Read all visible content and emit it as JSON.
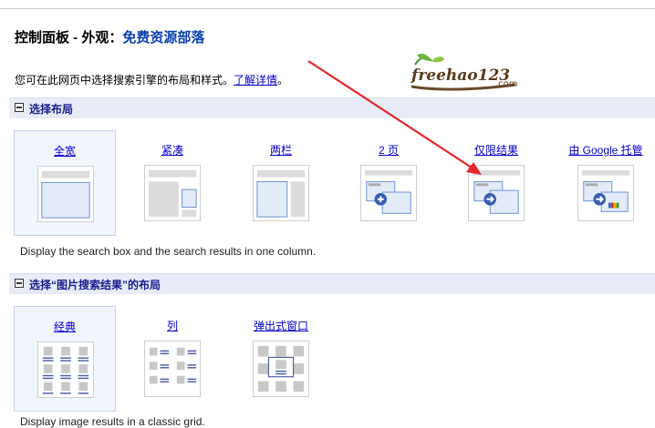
{
  "header": {
    "title_prefix": "控制面板 - 外观：",
    "title_site": "免费资源部落"
  },
  "intro": {
    "text": "您可在此网页中选择搜索引擎的布局和样式。",
    "link": "了解详情",
    "suffix": "。"
  },
  "logo": {
    "main": "freehao123",
    "suffix": ".com"
  },
  "layout_section": {
    "title": "选择布局",
    "options": [
      {
        "label": "全宽",
        "selected": true,
        "icon": "full-width-layout-icon"
      },
      {
        "label": "紧凑",
        "selected": false,
        "icon": "compact-layout-icon"
      },
      {
        "label": "两栏",
        "selected": false,
        "icon": "two-column-layout-icon"
      },
      {
        "label": "2 页",
        "selected": false,
        "icon": "two-page-layout-icon"
      },
      {
        "label": "仅限结果",
        "selected": false,
        "icon": "results-only-layout-icon"
      },
      {
        "label": "由 Google 托管",
        "selected": false,
        "icon": "google-hosted-layout-icon"
      }
    ],
    "note": "Display the search box and the search results in one column."
  },
  "image_section": {
    "title": "选择“图片搜索结果”的布局",
    "options": [
      {
        "label": "经典",
        "selected": true,
        "icon": "classic-image-layout-icon"
      },
      {
        "label": "列",
        "selected": false,
        "icon": "column-image-layout-icon"
      },
      {
        "label": "弹出式窗口",
        "selected": false,
        "icon": "popup-image-layout-icon"
      }
    ],
    "note": "Display image results in a classic grid."
  },
  "colors": {
    "link": "#0000cc",
    "section_bg": "#e7ecf7",
    "arrow": "#e8262a",
    "title_site": "#0a3fae"
  }
}
